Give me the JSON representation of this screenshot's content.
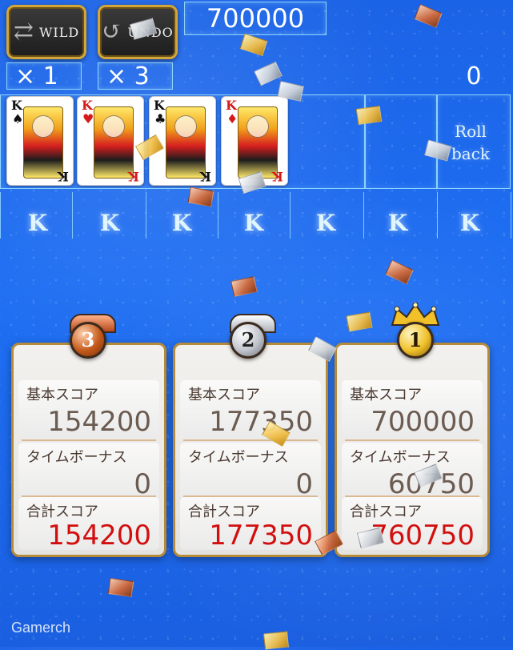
{
  "hud": {
    "wild_label": "WILD",
    "undo_label": "UNDO",
    "score": "700000",
    "wild_count": "× 1",
    "undo_count": "× 3",
    "right_count": "0",
    "rollback_label": "Roll back"
  },
  "cards": [
    {
      "rank": "K",
      "suit": "♠",
      "color": "black"
    },
    {
      "rank": "K",
      "suit": "♥",
      "color": "red"
    },
    {
      "rank": "K",
      "suit": "♣",
      "color": "black"
    },
    {
      "rank": "K",
      "suit": "♦",
      "color": "red"
    }
  ],
  "columns": [
    "K",
    "K",
    "K",
    "K",
    "K",
    "K",
    "K"
  ],
  "results": [
    {
      "place": "3",
      "basic_label": "基本スコア",
      "basic_value": "154200",
      "bonus_label": "タイムボーナス",
      "bonus_value": "0",
      "total_label": "合計スコア",
      "total_value": "154200"
    },
    {
      "place": "2",
      "basic_label": "基本スコア",
      "basic_value": "177350",
      "bonus_label": "タイムボーナス",
      "bonus_value": "0",
      "total_label": "合計スコア",
      "total_value": "177350"
    },
    {
      "place": "1",
      "basic_label": "基本スコア",
      "basic_value": "700000",
      "bonus_label": "タイムボーナス",
      "bonus_value": "60750",
      "total_label": "合計スコア",
      "total_value": "760750"
    }
  ],
  "watermark": "Gamerch"
}
